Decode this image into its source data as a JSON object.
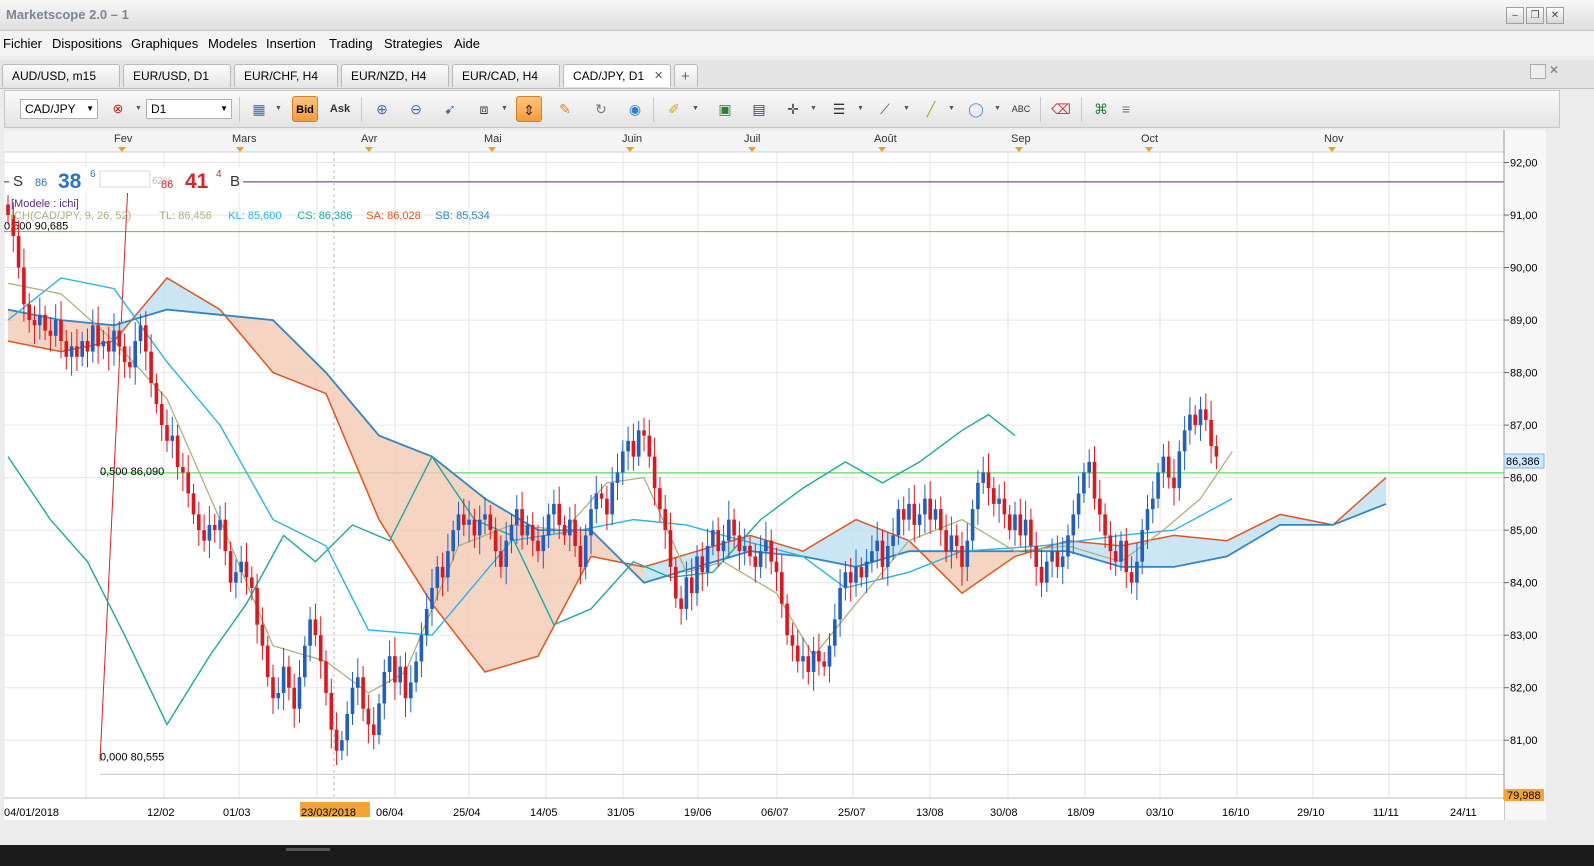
{
  "window": {
    "title": "Marketscope 2.0 – 1",
    "min_glyph": "‒",
    "max_glyph": "❐",
    "close_glyph": "✕"
  },
  "menu": [
    "Fichier",
    "Dispositions",
    "Graphiques",
    "Modeles",
    "Insertion",
    "Trading",
    "Strategies",
    "Aide"
  ],
  "tabs": [
    {
      "label": "AUD/USD, m15"
    },
    {
      "label": "EUR/USD, D1"
    },
    {
      "label": "EUR/CHF, H4"
    },
    {
      "label": "EUR/NZD, H4"
    },
    {
      "label": "EUR/CAD, H4"
    },
    {
      "label": "CAD/JPY, D1",
      "active": true,
      "close": "✕"
    }
  ],
  "add_tab": "+",
  "toolbar": {
    "symbol": "CAD/JPY",
    "timeframe": "D1",
    "bid": "Bid",
    "ask": "Ask",
    "more": "≡"
  },
  "quote": {
    "sell_label": "S",
    "sell_big": "86",
    "sell_main": "38",
    "sell_sup": "6",
    "spread": "62%",
    "buy_big": "86",
    "buy_main": "41",
    "buy_sup": "4",
    "buy_label": "B"
  },
  "model_label": "[Modele : ichi]",
  "indicator_line": [
    {
      "text": "ICH(CAD/JPY, 9, 26, 52)",
      "color": "#b0b07a"
    },
    {
      "text": "TL: 86,456",
      "color": "#b0b07a"
    },
    {
      "text": "KL: 85,600",
      "color": "#26b5e8"
    },
    {
      "text": "CS: 86,386",
      "color": "#1aaaa0"
    },
    {
      "text": "SA: 86,028",
      "color": "#e4551b"
    },
    {
      "text": "SB: 85,534",
      "color": "#2f86c8"
    }
  ],
  "fib_labels": [
    "0,500 90,685",
    "0,500 86,090",
    "0,000 80,555"
  ],
  "months": [
    "Fev",
    "Mars",
    "Avr",
    "Mai",
    "Juin",
    "Juil",
    "Août",
    "Sep",
    "Oct",
    "Nov"
  ],
  "dates": [
    "04/01/2018",
    "12/02",
    "01/03",
    "23/03/2018",
    "06/04",
    "25/04",
    "14/05",
    "31/05",
    "19/06",
    "06/07",
    "25/07",
    "13/08",
    "30/08",
    "18/09",
    "03/10",
    "16/10",
    "29/10",
    "11/11",
    "24/11"
  ],
  "price_ticks": [
    "92,00",
    "91,00",
    "90,00",
    "89,00",
    "88,00",
    "87,00",
    "86,00",
    "85,00",
    "84,00",
    "83,00",
    "82,00",
    "81,00"
  ],
  "current_price": "86,386",
  "low_price": "79,988",
  "colors": {
    "bull": "#1f5fc4",
    "bear": "#e0161c",
    "senkou_a": "#e4551b",
    "senkou_b": "#2f86c8",
    "tenkan": "#b0b07a",
    "kijun": "#26b5e8",
    "chikou": "#1aaaa0",
    "fib_line": "#3bd13b",
    "alert": "#7a1a6e"
  },
  "chart_data": {
    "type": "candlestick",
    "title": "CAD/JPY, D1",
    "ylim": [
      79.9,
      92.2
    ],
    "candles_close": [
      91.0,
      90.6,
      90.0,
      89.3,
      89.0,
      88.9,
      89.1,
      88.8,
      88.7,
      89.0,
      88.6,
      88.3,
      88.5,
      88.3,
      88.6,
      88.4,
      88.9,
      88.5,
      88.6,
      88.4,
      88.8,
      88.5,
      88.2,
      88.1,
      88.6,
      88.9,
      88.4,
      87.8,
      87.4,
      87.0,
      86.7,
      86.8,
      86.2,
      86.1,
      85.7,
      85.3,
      85.0,
      84.8,
      85.1,
      85.0,
      85.2,
      84.6,
      84.0,
      84.2,
      84.4,
      84.1,
      83.9,
      83.2,
      82.8,
      82.2,
      81.8,
      81.9,
      82.4,
      82.0,
      81.6,
      82.2,
      82.8,
      83.3,
      83.0,
      82.5,
      81.9,
      81.2,
      80.8,
      81.0,
      81.5,
      82.0,
      82.2,
      81.6,
      81.3,
      81.1,
      81.7,
      82.3,
      82.6,
      82.1,
      82.4,
      81.8,
      82.1,
      82.5,
      83.0,
      83.5,
      83.9,
      84.3,
      84.1,
      84.6,
      85.0,
      85.3,
      85.1,
      85.2,
      84.9,
      85.2,
      85.3,
      85.0,
      84.6,
      84.3,
      84.8,
      85.1,
      85.4,
      84.9,
      85.1,
      84.8,
      84.6,
      84.9,
      85.3,
      85.5,
      85.1,
      84.9,
      85.2,
      84.7,
      84.3,
      84.9,
      85.4,
      85.7,
      85.6,
      85.3,
      85.9,
      86.1,
      86.5,
      86.7,
      86.4,
      86.9,
      86.8,
      86.4,
      85.8,
      85.4,
      85.0,
      84.3,
      83.7,
      83.5,
      84.1,
      83.8,
      84.5,
      84.2,
      84.7,
      85.0,
      84.6,
      84.8,
      85.2,
      84.9,
      84.6,
      84.7,
      84.5,
      84.3,
      84.6,
      84.8,
      84.4,
      84.2,
      83.6,
      83.0,
      82.8,
      82.5,
      82.6,
      82.3,
      82.7,
      82.5,
      82.4,
      82.8,
      83.3,
      83.9,
      84.2,
      84.0,
      84.3,
      84.1,
      84.4,
      84.6,
      84.8,
      84.3,
      84.7,
      84.9,
      85.4,
      85.2,
      85.5,
      85.1,
      85.3,
      85.6,
      85.2,
      85.4,
      85.0,
      84.6,
      84.9,
      84.7,
      84.3,
      84.8,
      85.4,
      85.9,
      86.1,
      85.8,
      85.5,
      85.6,
      85.3,
      85.0,
      85.3,
      84.9,
      85.2,
      84.7,
      84.3,
      84.0,
      84.4,
      84.6,
      84.3,
      84.5,
      84.9,
      85.3,
      85.7,
      86.1,
      86.3,
      85.6,
      85.3,
      84.9,
      84.6,
      84.4,
      84.8,
      84.2,
      84.0,
      84.4,
      85.0,
      85.4,
      85.6,
      86.1,
      86.4,
      86.0,
      85.8,
      86.5,
      86.9,
      87.2,
      87.0,
      87.3,
      87.1,
      86.6,
      86.4
    ],
    "tenkan": [
      [
        0,
        89.7
      ],
      [
        10,
        89.5
      ],
      [
        20,
        88.6
      ],
      [
        30,
        87.5
      ],
      [
        40,
        85.2
      ],
      [
        50,
        82.8
      ],
      [
        60,
        82.5
      ],
      [
        68,
        81.9
      ],
      [
        75,
        82.3
      ],
      [
        85,
        84.7
      ],
      [
        95,
        85.1
      ],
      [
        105,
        85.0
      ],
      [
        113,
        85.9
      ],
      [
        120,
        86.0
      ],
      [
        128,
        84.2
      ],
      [
        135,
        84.4
      ],
      [
        145,
        83.8
      ],
      [
        152,
        82.6
      ],
      [
        160,
        83.6
      ],
      [
        170,
        84.8
      ],
      [
        180,
        85.2
      ],
      [
        190,
        84.6
      ],
      [
        200,
        84.7
      ],
      [
        210,
        84.4
      ],
      [
        218,
        85.0
      ],
      [
        225,
        85.6
      ],
      [
        231,
        86.5
      ]
    ],
    "kijun": [
      [
        0,
        89.0
      ],
      [
        10,
        89.8
      ],
      [
        20,
        89.6
      ],
      [
        30,
        88.2
      ],
      [
        40,
        87.0
      ],
      [
        50,
        85.2
      ],
      [
        60,
        84.7
      ],
      [
        68,
        83.1
      ],
      [
        80,
        83.0
      ],
      [
        95,
        84.8
      ],
      [
        108,
        85.0
      ],
      [
        118,
        85.2
      ],
      [
        128,
        85.1
      ],
      [
        135,
        84.9
      ],
      [
        150,
        84.5
      ],
      [
        158,
        83.9
      ],
      [
        170,
        84.2
      ],
      [
        180,
        84.6
      ],
      [
        195,
        84.7
      ],
      [
        210,
        84.9
      ],
      [
        220,
        85.0
      ],
      [
        231,
        85.6
      ]
    ],
    "chikou": [
      [
        0,
        86.4
      ],
      [
        8,
        85.2
      ],
      [
        15,
        84.4
      ],
      [
        22,
        83.0
      ],
      [
        30,
        81.3
      ],
      [
        38,
        82.6
      ],
      [
        45,
        83.6
      ],
      [
        52,
        84.9
      ],
      [
        58,
        84.4
      ],
      [
        65,
        85.1
      ],
      [
        72,
        84.8
      ],
      [
        80,
        86.4
      ],
      [
        88,
        85.2
      ],
      [
        95,
        84.9
      ],
      [
        103,
        83.2
      ],
      [
        110,
        83.5
      ],
      [
        118,
        84.4
      ],
      [
        125,
        84.1
      ],
      [
        133,
        84.2
      ],
      [
        142,
        85.2
      ],
      [
        150,
        85.8
      ],
      [
        158,
        86.3
      ],
      [
        165,
        85.9
      ],
      [
        172,
        86.3
      ],
      [
        180,
        86.9
      ],
      [
        185,
        87.2
      ],
      [
        190,
        86.8
      ]
    ],
    "senkou_a": [
      [
        0,
        88.6
      ],
      [
        10,
        88.4
      ],
      [
        20,
        88.6
      ],
      [
        30,
        89.8
      ],
      [
        40,
        89.2
      ],
      [
        50,
        88.0
      ],
      [
        60,
        87.6
      ],
      [
        70,
        85.2
      ],
      [
        80,
        83.6
      ],
      [
        90,
        82.3
      ],
      [
        100,
        82.6
      ],
      [
        110,
        84.5
      ],
      [
        120,
        84.3
      ],
      [
        130,
        84.6
      ],
      [
        140,
        84.9
      ],
      [
        150,
        84.6
      ],
      [
        160,
        85.2
      ],
      [
        170,
        84.8
      ],
      [
        180,
        83.8
      ],
      [
        190,
        84.5
      ],
      [
        200,
        84.8
      ],
      [
        210,
        84.7
      ],
      [
        220,
        84.9
      ],
      [
        230,
        84.8
      ],
      [
        240,
        85.3
      ],
      [
        250,
        85.1
      ],
      [
        260,
        86.0
      ]
    ],
    "senkou_b": [
      [
        0,
        89.2
      ],
      [
        10,
        89.0
      ],
      [
        20,
        88.9
      ],
      [
        30,
        89.2
      ],
      [
        40,
        89.1
      ],
      [
        50,
        89.0
      ],
      [
        60,
        88.0
      ],
      [
        70,
        86.8
      ],
      [
        80,
        86.4
      ],
      [
        90,
        85.6
      ],
      [
        100,
        85.0
      ],
      [
        110,
        85.0
      ],
      [
        120,
        84.0
      ],
      [
        130,
        84.3
      ],
      [
        140,
        84.6
      ],
      [
        150,
        84.5
      ],
      [
        160,
        84.3
      ],
      [
        170,
        84.6
      ],
      [
        180,
        84.6
      ],
      [
        190,
        84.6
      ],
      [
        200,
        84.6
      ],
      [
        210,
        84.3
      ],
      [
        220,
        84.3
      ],
      [
        230,
        84.5
      ],
      [
        240,
        85.1
      ],
      [
        250,
        85.1
      ],
      [
        260,
        85.5
      ]
    ],
    "horizontal_lines": [
      90.685,
      86.09
    ],
    "alert_level": 91.63
  }
}
